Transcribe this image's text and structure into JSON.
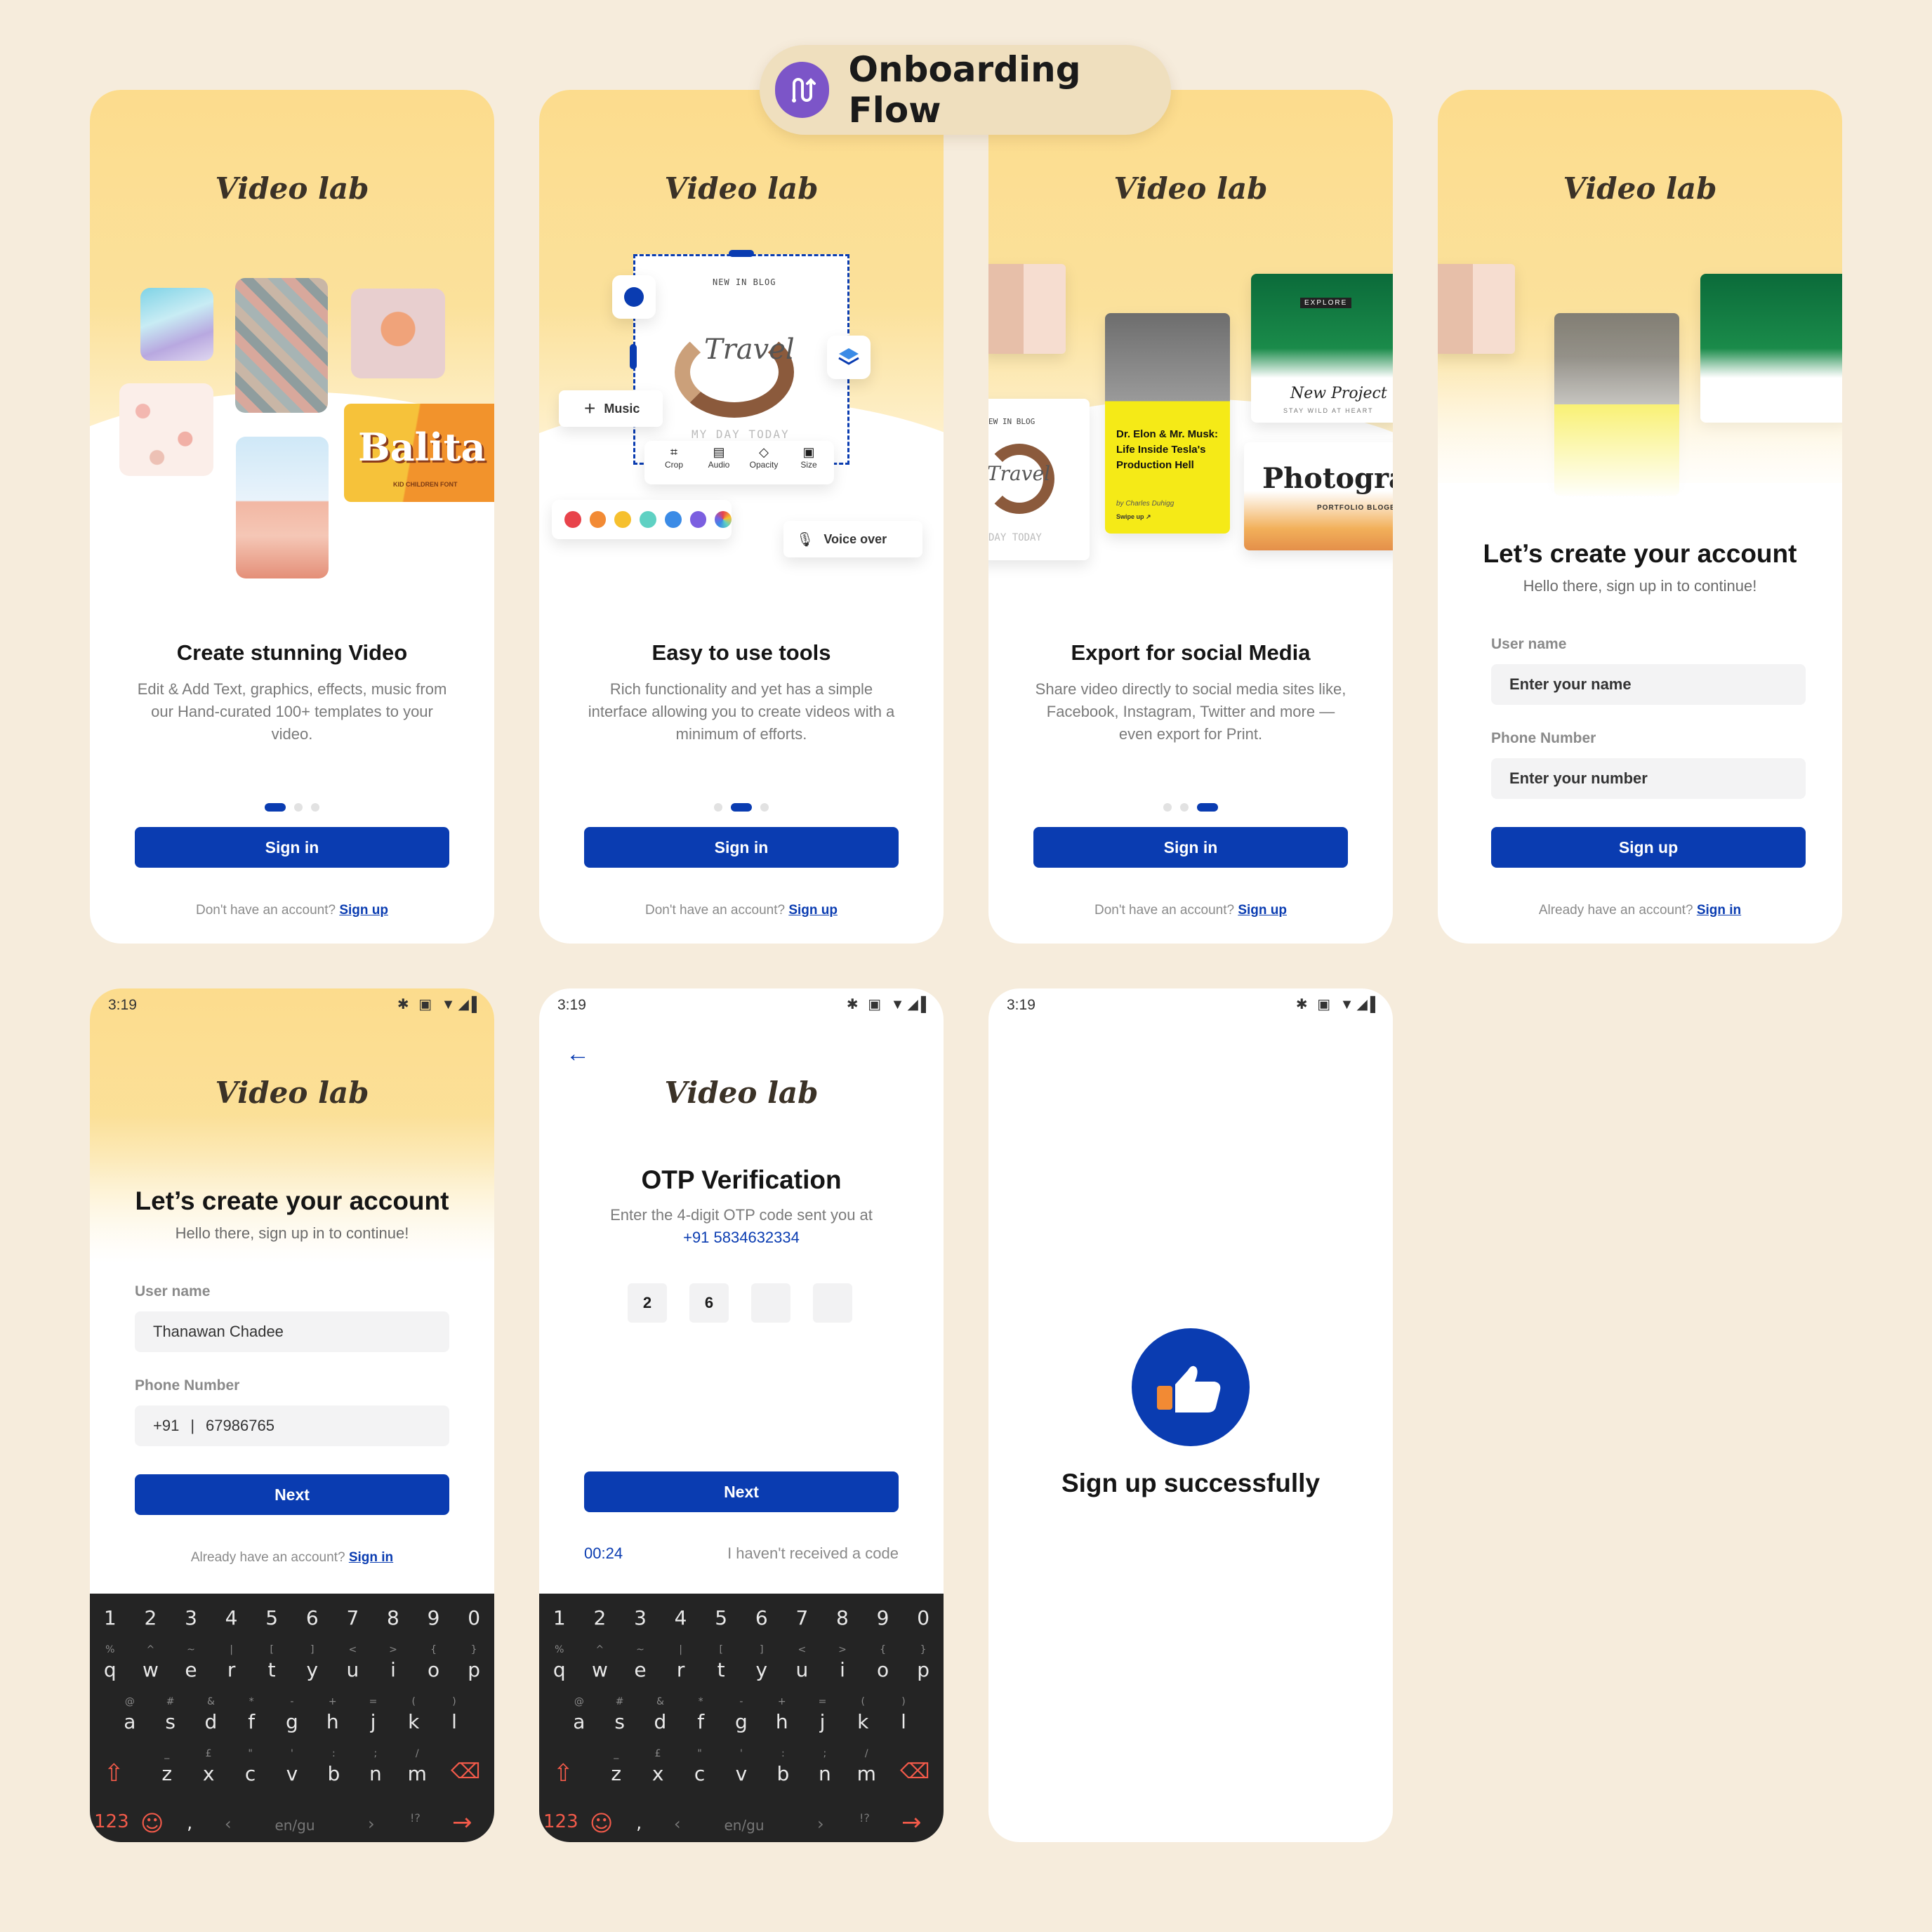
{
  "header": {
    "title": "Onboarding Flow"
  },
  "brand": "Video lab",
  "slides": [
    {
      "title": "Create stunning Video",
      "desc": "Edit & Add Text, graphics, effects, music from our Hand-curated 100+ templates to your video."
    },
    {
      "title": "Easy to use tools",
      "desc": "Rich functionality and yet has a simple interface allowing you to create videos with a minimum of efforts."
    },
    {
      "title": "Export for social Media",
      "desc": "Share video directly to social media sites like, Facebook, Instagram, Twitter and more — even export for Print."
    }
  ],
  "signin_button": "Sign in",
  "footer_prompt": "Don't have an account?",
  "footer_link": "Sign up",
  "collage1": {
    "balita_text": "Balita",
    "balita_sub": "KID CHILDREN FONT"
  },
  "editor": {
    "blog_label": "NEW IN BLOG",
    "travel_text": "Travel",
    "myday_text": "MY DAY TODAY",
    "music_label": "Music",
    "tools": [
      "Crop",
      "Audio",
      "Opacity",
      "Size"
    ],
    "voiceover_label": "Voice over",
    "swatches": [
      "#e8434b",
      "#f28a34",
      "#f6c02e",
      "#5fd1c3",
      "#3b8be6",
      "#7b5fe0"
    ]
  },
  "social": {
    "blog_label": "EW IN BLOG",
    "travel_text": "Travel",
    "today_text": "DAY TODAY",
    "elon_title": "Dr. Elon & Mr. Musk: Life Inside Tesla's Production Hell",
    "elon_author": "by Charles Duhigg",
    "elon_swipe": "Swipe up ↗",
    "explore_label": "EXPLORE",
    "project_title": "New Project",
    "project_sub": "STAY WILD AT HEART",
    "photo_title": "Photogray",
    "photo_sub": "PORTFOLIO BLOGER"
  },
  "signup": {
    "title": "Let’s create your account",
    "subtitle": "Hello there, sign up in to continue!",
    "username_label": "User name",
    "username_placeholder": "Enter your name",
    "phone_label": "Phone Number",
    "phone_placeholder": "Enter your number",
    "button": "Sign up",
    "footer_prompt": "Already have an account?",
    "footer_link": "Sign in"
  },
  "status": {
    "time": "3:19",
    "icons": "✱ ▣ ▼◢▌"
  },
  "signup_filled": {
    "title": "Let’s create your account",
    "subtitle": "Hello there, sign up in to continue!",
    "username_label": "User name",
    "username_value": "Thanawan Chadee",
    "phone_label": "Phone Number",
    "phone_code": "+91",
    "phone_value": "67986765",
    "button": "Next",
    "footer_prompt": "Already have an account?",
    "footer_link": "Sign in"
  },
  "otp": {
    "title": "OTP Verification",
    "desc": "Enter the 4-digit OTP code sent you at",
    "phone": "+91 5834632334",
    "digits": [
      "2",
      "6",
      "",
      ""
    ],
    "button": "Next",
    "timer": "00:24",
    "resend": "I haven't received a code"
  },
  "success": {
    "text": "Sign up successfully"
  },
  "keyboard": {
    "numbers": [
      "1",
      "2",
      "3",
      "4",
      "5",
      "6",
      "7",
      "8",
      "9",
      "0"
    ],
    "row1": [
      "q",
      "w",
      "e",
      "r",
      "t",
      "y",
      "u",
      "i",
      "o",
      "p"
    ],
    "row1_sub": [
      "%",
      "^",
      "~",
      "|",
      "[",
      "]",
      "<",
      ">",
      "{",
      "}"
    ],
    "row2": [
      "a",
      "s",
      "d",
      "f",
      "g",
      "h",
      "j",
      "k",
      "l"
    ],
    "row2_sub": [
      "@",
      "#",
      "&",
      "*",
      "-",
      "+",
      "=",
      "(",
      ")"
    ],
    "row3": [
      "z",
      "x",
      "c",
      "v",
      "b",
      "n",
      "m"
    ],
    "row3_sub": [
      "_",
      "£",
      "\"",
      "'",
      ":",
      ";",
      "/"
    ],
    "mode_key": "123",
    "lang": "en/gu",
    "punct": ",",
    "punct_sub": "!?"
  },
  "colors": {
    "accent": "#0a3cb1",
    "hero": "#fcdc8d",
    "background": "#f6ecdc",
    "keyboard": "#242424",
    "keyboard_accent": "#f25a4a"
  }
}
